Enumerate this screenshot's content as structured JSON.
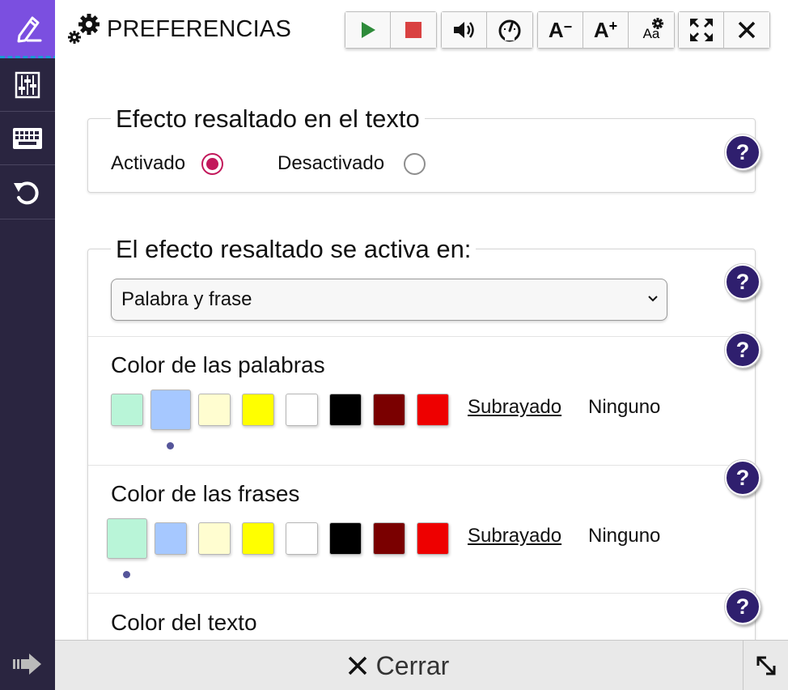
{
  "header": {
    "title": "PREFERENCIAS",
    "toolbar": {
      "play": "play-icon",
      "stop": "stop-icon",
      "volume": "volume-icon",
      "speed": "speedometer-icon",
      "font_decrease": "A",
      "font_increase": "A",
      "font_settings": "Aa",
      "fullscreen": "fullscreen-icon",
      "close": "close-icon"
    }
  },
  "sidebar": {
    "items": [
      {
        "icon": "highlighter-pen-icon",
        "active": true
      },
      {
        "icon": "sliders-icon",
        "active": false
      },
      {
        "icon": "keyboard-icon",
        "active": false
      },
      {
        "icon": "reset-icon",
        "active": false
      }
    ],
    "collapse_icon": "arrow-right-icon"
  },
  "sections": {
    "highlight_effect": {
      "legend": "Efecto resaltado en el texto",
      "options": [
        "Activado",
        "Desactivado"
      ],
      "selected": "Activado",
      "help": "?"
    },
    "activation": {
      "legend": "El efecto resaltado se activa en:",
      "select_value": "Palabra y frase",
      "help": "?"
    },
    "word_color": {
      "title": "Color de las palabras",
      "underline_label": "Subrayado",
      "none_label": "Ninguno",
      "selected_index": 1,
      "help": "?"
    },
    "phrase_color": {
      "title": "Color de las frases",
      "underline_label": "Subrayado",
      "none_label": "Ninguno",
      "selected_index": 0,
      "help": "?"
    },
    "text_color": {
      "title": "Color del texto",
      "help": "?"
    }
  },
  "swatch_colors": [
    "#b9f5d8",
    "#a6c8ff",
    "#fffdd0",
    "#ffff00",
    "#ffffff",
    "#000000",
    "#7a0000",
    "#ee0000"
  ],
  "colors": {
    "sidebar_bg": "#2a2540",
    "sidebar_active": "#7b4fe0",
    "help_bg": "#2f1f6e",
    "radio_checked": "#c2185b",
    "footer_bg": "#e9e9e9"
  },
  "footer": {
    "close_label": "Cerrar",
    "resize_icon": "resize-icon"
  }
}
